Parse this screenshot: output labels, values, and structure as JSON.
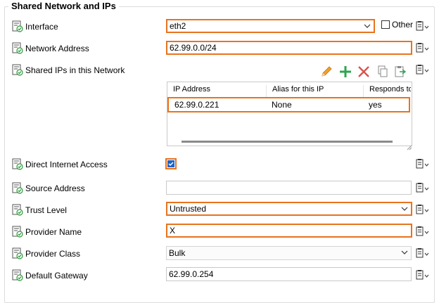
{
  "group": {
    "title": "Shared Network and IPs"
  },
  "fields": {
    "interface": {
      "label": "Interface",
      "value": "eth2",
      "other_label": "Other"
    },
    "network_address": {
      "label": "Network Address",
      "value": "62.99.0.0/24"
    },
    "shared_ips": {
      "label": "Shared IPs in this Network",
      "columns": [
        "IP Address",
        "Alias for this IP",
        "Responds to"
      ],
      "rows": [
        {
          "ip": "62.99.0.221",
          "alias": "None",
          "responds": "yes"
        }
      ]
    },
    "direct_internet_access": {
      "label": "Direct Internet Access",
      "checked": true
    },
    "source_address": {
      "label": "Source Address",
      "value": ""
    },
    "trust_level": {
      "label": "Trust Level",
      "value": "Untrusted"
    },
    "provider_name": {
      "label": "Provider Name",
      "value": "X"
    },
    "provider_class": {
      "label": "Provider Class",
      "value": "Bulk"
    },
    "default_gateway": {
      "label": "Default Gateway",
      "value": "62.99.0.254"
    }
  },
  "icons": {
    "row": "config-setting-icon",
    "context": "clipboard-menu-icon",
    "toolbar": [
      "edit-pencil-icon",
      "add-plus-icon",
      "delete-x-icon",
      "copy-icon",
      "paste-icon"
    ]
  },
  "colors": {
    "highlight": "#e8731e",
    "check_fill": "#1e63c6",
    "add_green": "#2ea44f",
    "delete_red": "#d9534f",
    "edit_orange": "#f0a030"
  }
}
